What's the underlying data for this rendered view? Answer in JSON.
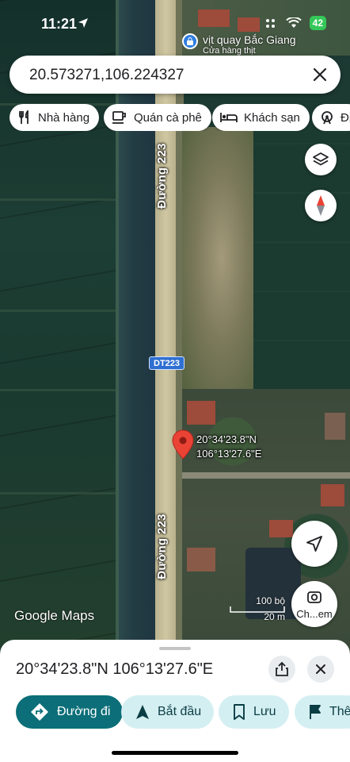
{
  "status_bar": {
    "time": "11:21",
    "battery": "42"
  },
  "place_hint": {
    "name": "vịt quay Bắc Giang",
    "subtitle": "Cửa hàng thịt"
  },
  "search": {
    "value": "20.573271,106.224327"
  },
  "chips": [
    {
      "label": "Nhà hàng",
      "icon": "fork-knife-icon"
    },
    {
      "label": "Quán cà phê",
      "icon": "coffee-icon"
    },
    {
      "label": "Khách sạn",
      "icon": "bed-icon"
    },
    {
      "label": "Đị",
      "icon": "ferris-wheel-icon"
    }
  ],
  "map": {
    "road_label_top": "Đường 223",
    "road_label_bottom": "Đường 223",
    "route_shield": "DT223",
    "pin_label_lat": "20°34'23.8\"N",
    "pin_label_lng": "106°13'27.6\"E",
    "logo": "Google Maps",
    "scale_ft": "100 bộ",
    "scale_m": "20 m",
    "ch_label": "Ch...em"
  },
  "sheet": {
    "title": "20°34'23.8\"N 106°13'27.6\"E",
    "actions": [
      {
        "label": "Đường đi",
        "icon": "directions-icon"
      },
      {
        "label": "Bắt đầu",
        "icon": "navigation-arrow-icon"
      },
      {
        "label": "Lưu",
        "icon": "bookmark-icon"
      },
      {
        "label": "Thê",
        "icon": "flag-icon"
      }
    ]
  },
  "colors": {
    "primary": "#0b6e78",
    "secondary_chip": "#d4eff2",
    "pin": "#ea4335",
    "battery": "#34c759"
  }
}
